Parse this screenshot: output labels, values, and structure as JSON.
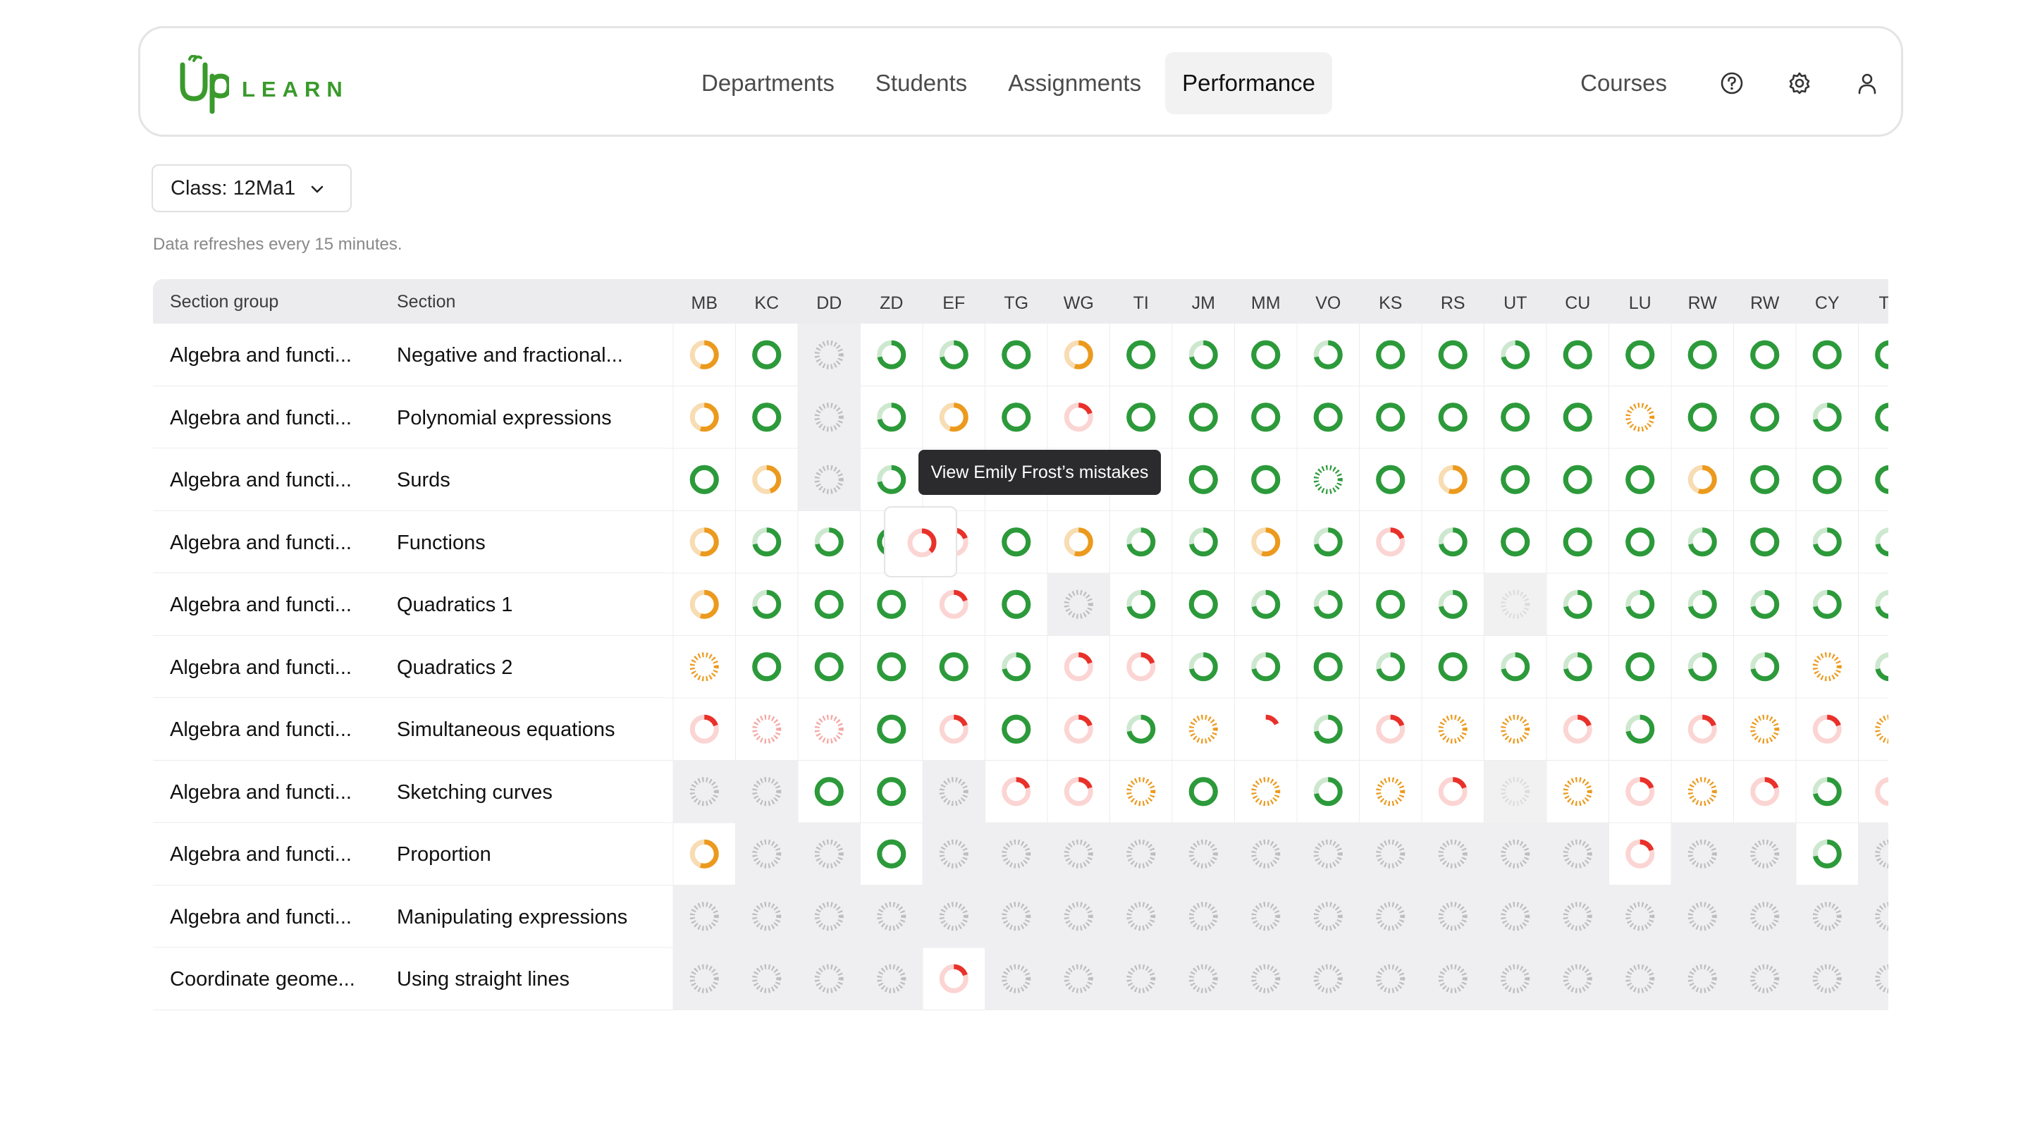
{
  "brand": {
    "logo_text": "LEARN",
    "logo_color": "#3a9a2c"
  },
  "nav": {
    "items": [
      {
        "label": "Departments",
        "active": false
      },
      {
        "label": "Students",
        "active": false
      },
      {
        "label": "Assignments",
        "active": false
      },
      {
        "label": "Performance",
        "active": true
      }
    ],
    "courses_label": "Courses",
    "icons": [
      "help-icon",
      "settings-icon",
      "user-icon"
    ]
  },
  "class_select": {
    "label": "Class: 12Ma1"
  },
  "refresh_note": "Data refreshes every 15 minutes.",
  "table": {
    "col_group": "Section group",
    "col_section": "Section",
    "students": [
      "MB",
      "KC",
      "DD",
      "ZD",
      "EF",
      "TG",
      "WG",
      "TI",
      "JM",
      "MM",
      "VO",
      "KS",
      "RS",
      "UT",
      "CU",
      "LU",
      "RW",
      "RW",
      "CY",
      "TZ"
    ],
    "rows": [
      {
        "group": "Algebra and functi...",
        "section": "Negative and fractional...",
        "cells": [
          "O",
          "G",
          "N",
          "G3",
          "G3",
          "G",
          "O",
          "G",
          "G3",
          "G",
          "G3",
          "G",
          "G",
          "G3",
          "G",
          "G",
          "G",
          "G",
          "G",
          "G"
        ]
      },
      {
        "group": "Algebra and functi...",
        "section": "Polynomial expressions",
        "cells": [
          "O",
          "G",
          "N",
          "G3",
          "O",
          "G",
          "R",
          "G",
          "G",
          "G",
          "G",
          "G",
          "G",
          "G",
          "G",
          "OD",
          "G",
          "G",
          "G3",
          "G"
        ]
      },
      {
        "group": "Algebra and functi...",
        "section": "Surds",
        "cells": [
          "G",
          "OL",
          "N",
          "G3",
          "O",
          "G",
          "G",
          "G",
          "G",
          "G",
          "GD",
          "G",
          "O",
          "G",
          "G",
          "G",
          "O",
          "G",
          "G",
          "G"
        ]
      },
      {
        "group": "Algebra and functi...",
        "section": "Functions",
        "cells": [
          "O",
          "G3",
          "G3",
          "G",
          "R",
          "G",
          "O",
          "G3",
          "G3",
          "O",
          "G3",
          "R",
          "G3",
          "G",
          "G",
          "G",
          "G3",
          "G",
          "G3",
          "G3"
        ]
      },
      {
        "group": "Algebra and functi...",
        "section": "Quadratics 1",
        "cells": [
          "O",
          "G3",
          "G",
          "G",
          "R",
          "G",
          "NG",
          "G3",
          "G",
          "G3",
          "G3",
          "G",
          "G3",
          "NGL",
          "G3",
          "G3",
          "G3",
          "G3",
          "G3",
          "G3"
        ]
      },
      {
        "group": "Algebra and functi...",
        "section": "Quadratics 2",
        "cells": [
          "OD",
          "G",
          "G",
          "G",
          "G",
          "G3",
          "R",
          "R",
          "G3",
          "G3",
          "G",
          "G3",
          "G",
          "G3",
          "G3",
          "G",
          "G3",
          "G3",
          "OD",
          "G3"
        ]
      },
      {
        "group": "Algebra and functi...",
        "section": "Simultaneous equations",
        "cells": [
          "R",
          "RD",
          "RD",
          "G",
          "R",
          "G",
          "R",
          "G3",
          "OD",
          "RX",
          "G3",
          "R",
          "OD",
          "OD",
          "R",
          "G3",
          "R",
          "OD",
          "R",
          "OD"
        ]
      },
      {
        "group": "Algebra and functi...",
        "section": "Sketching curves",
        "cells": [
          "NG",
          "NG",
          "G",
          "G",
          "NG",
          "R",
          "R",
          "OD",
          "G",
          "OD",
          "G3",
          "OD",
          "R",
          "NGL",
          "OD",
          "R",
          "OD",
          "R",
          "G3",
          "R"
        ]
      },
      {
        "group": "Algebra and functi...",
        "section": "Proportion",
        "cells": [
          "O",
          "NG",
          "NG",
          "G",
          "NG",
          "NG",
          "NG",
          "NG",
          "NG",
          "NG",
          "NG",
          "NG",
          "NG",
          "NG",
          "NG",
          "R",
          "NG",
          "NG",
          "G3",
          "NG"
        ]
      },
      {
        "group": "Algebra and functi...",
        "section": "Manipulating expressions",
        "cells": [
          "NG",
          "NG",
          "NG",
          "NG",
          "NG",
          "NG",
          "NG",
          "NG",
          "NG",
          "NG",
          "NG",
          "NG",
          "NG",
          "NG",
          "NG",
          "NG",
          "NG",
          "NG",
          "NG",
          "NG"
        ]
      },
      {
        "group": "Coordinate geome...",
        "section": "Using straight lines",
        "cells": [
          "NG",
          "NG",
          "NG",
          "NG",
          "R",
          "NG",
          "NG",
          "NG",
          "NG",
          "NG",
          "NG",
          "NG",
          "NG",
          "NG",
          "NG",
          "NG",
          "NG",
          "NG",
          "NG",
          "NG"
        ]
      }
    ]
  },
  "tooltip": {
    "text": "View Emily Frost’s mistakes"
  },
  "colors": {
    "green": "#2c9a3a",
    "orange": "#eb9a1e",
    "red": "#e8312a",
    "grey": "#bdbdbd",
    "header_bg": "#ececee"
  }
}
